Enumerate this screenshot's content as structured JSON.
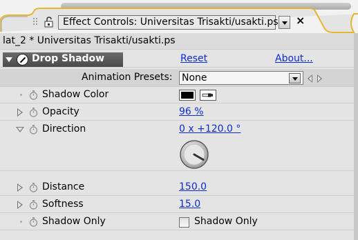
{
  "panel_tab": {
    "title": "Effect Controls: Universitas  Trisakti/usakti.ps",
    "menu_icon": "dropdown-arrow-icon",
    "close_label": "×"
  },
  "composition": {
    "label": "lat_2 * Universitas  Trisakti/usakti.ps"
  },
  "effect": {
    "name": "Drop Shadow",
    "reset_label": "Reset",
    "about_label": "About...",
    "presets_label": "Animation Presets:",
    "preset_value": "None"
  },
  "properties": {
    "shadow_color": {
      "label": "Shadow Color",
      "value": "#000000"
    },
    "opacity": {
      "label": "Opacity",
      "value": "96 %"
    },
    "direction": {
      "label": "Direction",
      "value": "0 x +120.0 °",
      "angle_degrees": 120
    },
    "distance": {
      "label": "Distance",
      "value": "150.0"
    },
    "softness": {
      "label": "Softness",
      "value": "15.0"
    },
    "shadow_only": {
      "label": "Shadow Only",
      "checkbox_label": "Shadow Only",
      "checked": false
    }
  },
  "colors": {
    "accent_tab_outline": "#e8b530",
    "link": "#0b2ad8",
    "effect_header": "#555555"
  }
}
